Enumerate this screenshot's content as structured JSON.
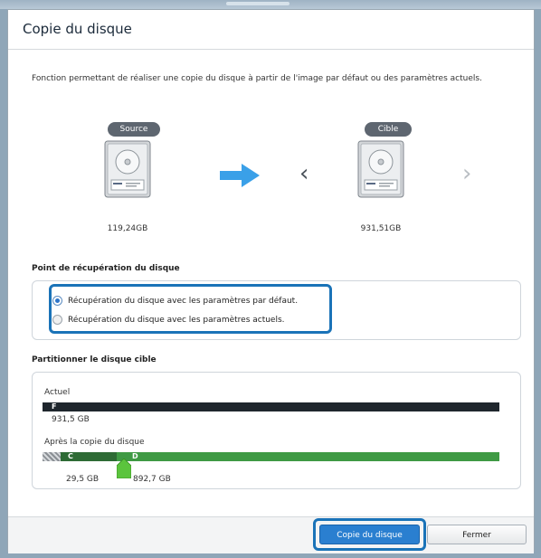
{
  "dialog": {
    "title": "Copie du disque",
    "description": "Fonction permettant de réaliser une copie du disque à partir de l'image par défaut ou des paramètres actuels."
  },
  "source": {
    "badge": "Source",
    "size": "119,24GB"
  },
  "target": {
    "badge": "Cible",
    "size": "931,51GB"
  },
  "recovery": {
    "section_title": "Point de récupération du disque",
    "options": [
      {
        "label": "Récupération du disque avec les paramètres par défaut.",
        "selected": true
      },
      {
        "label": "Récupération du disque avec les paramètres actuels.",
        "selected": false
      }
    ]
  },
  "partition": {
    "section_title": "Partitionner le disque cible",
    "current_label": "Actuel",
    "current_partition_letter": "F",
    "current_size": "931,5 GB",
    "after_label": "Après la copie du disque",
    "after_partitions": [
      {
        "letter": "C",
        "size": "29,5 GB"
      },
      {
        "letter": "D",
        "size": "892,7 GB"
      }
    ]
  },
  "buttons": {
    "copy": "Copie du disque",
    "close": "Fermer"
  },
  "colors": {
    "accent": "#2a7fd0",
    "current_bar": "#1f262d",
    "partition_c": "#2e6b35",
    "partition_d": "#3f9a44",
    "arrow": "#3aa0e8"
  }
}
